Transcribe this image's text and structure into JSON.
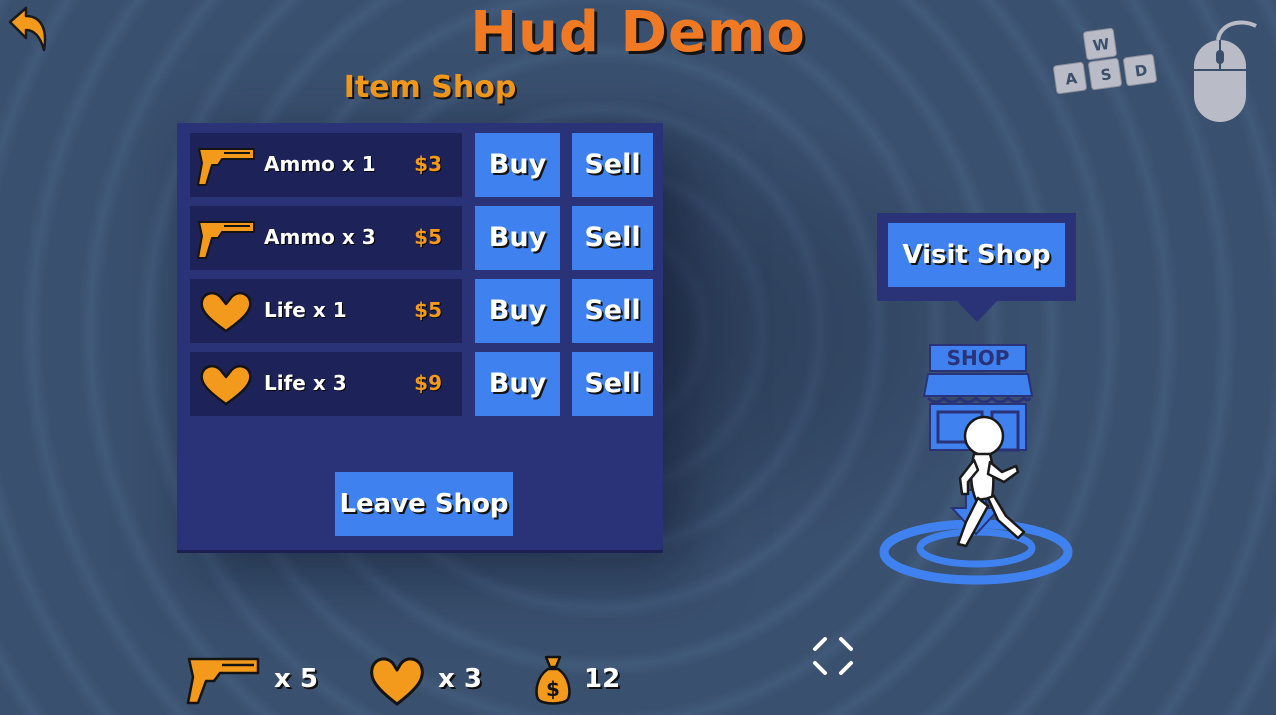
{
  "title": "Hud Demo",
  "shop": {
    "label": "Item Shop",
    "items": [
      {
        "name": "Ammo x 1",
        "price": "$3",
        "icon": "gun-icon",
        "buy_label": "Buy",
        "sell_label": "Sell"
      },
      {
        "name": "Ammo x 3",
        "price": "$5",
        "icon": "gun-icon",
        "buy_label": "Buy",
        "sell_label": "Sell"
      },
      {
        "name": "Life x 1",
        "price": "$5",
        "icon": "heart-icon",
        "buy_label": "Buy",
        "sell_label": "Sell"
      },
      {
        "name": "Life x 3",
        "price": "$9",
        "icon": "heart-icon",
        "buy_label": "Buy",
        "sell_label": "Sell"
      }
    ],
    "leave_label": "Leave Shop"
  },
  "visit": {
    "label": "Visit Shop",
    "sign_text": "SHOP"
  },
  "controls": {
    "keys": [
      "W",
      "A",
      "S",
      "D"
    ],
    "icons": [
      "keyboard-wasd-icon",
      "mouse-icon"
    ]
  },
  "hud": {
    "ammo": "x 5",
    "lives": "x 3",
    "money": "12",
    "money_symbol": "$"
  },
  "colors": {
    "accent_orange": "#f07a23",
    "price_orange": "#f39a1c",
    "button_blue": "#3f82ef",
    "panel_navy": "#2a3278",
    "cell_navy": "#1d2358"
  }
}
